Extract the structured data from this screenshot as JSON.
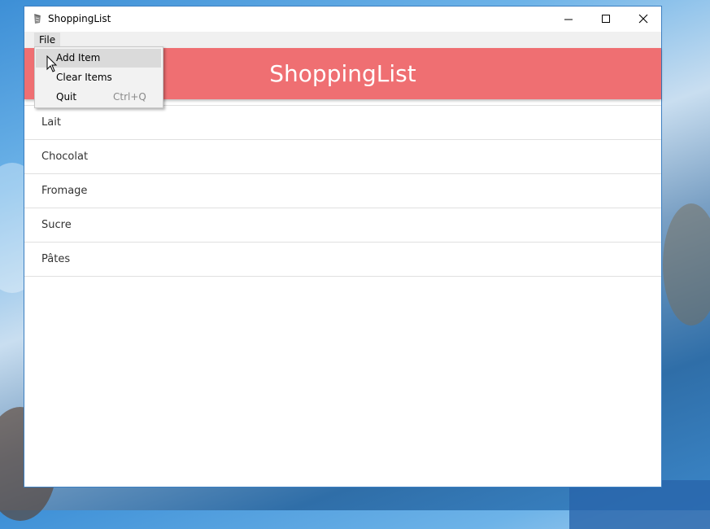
{
  "window": {
    "title": "ShoppingList",
    "controls": {
      "minimize_icon": "minimize-icon",
      "maximize_icon": "maximize-icon",
      "close_icon": "close-icon"
    }
  },
  "menubar": {
    "file_label": "File"
  },
  "file_menu": {
    "items": [
      {
        "label": "Add Item",
        "shortcut": ""
      },
      {
        "label": "Clear Items",
        "shortcut": ""
      },
      {
        "label": "Quit",
        "shortcut": "Ctrl+Q"
      }
    ]
  },
  "header": {
    "title": "ShoppingList",
    "color": "#ef6f72"
  },
  "list": {
    "items": [
      "Lait",
      "Chocolat",
      "Fromage",
      "Sucre",
      "Pâtes"
    ]
  },
  "colors": {
    "accent": "#ef6f72",
    "window_border": "#3c7fc1"
  }
}
